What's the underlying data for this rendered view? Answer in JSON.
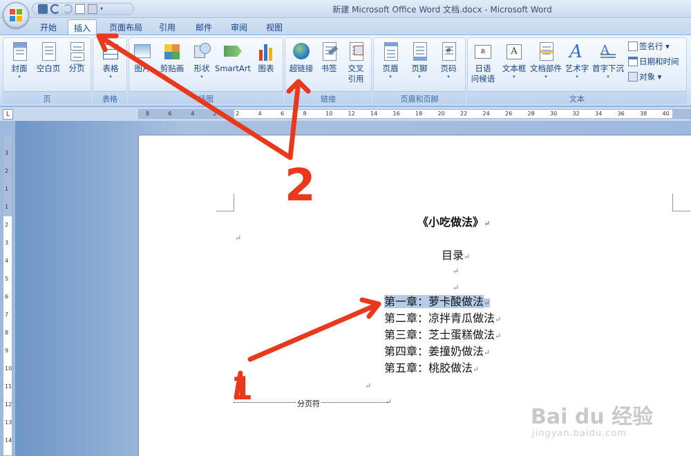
{
  "window": {
    "title": "新建 Microsoft Office Word 文档.docx - Microsoft Word"
  },
  "tabs": [
    "开始",
    "插入",
    "页面布局",
    "引用",
    "邮件",
    "审阅",
    "视图"
  ],
  "active_tab": "插入",
  "ribbon": {
    "groups": {
      "pages": {
        "label": "页",
        "cmds": [
          "封面",
          "空白页",
          "分页"
        ]
      },
      "tables": {
        "label": "表格",
        "cmds": [
          "表格"
        ]
      },
      "illustrations": {
        "label": "插图",
        "cmds": [
          "图片",
          "剪贴画",
          "形状",
          "SmartArt",
          "图表"
        ]
      },
      "links": {
        "label": "链接",
        "cmds": [
          "超链接",
          "书签",
          "交叉",
          "引用"
        ]
      },
      "header_footer": {
        "label": "页眉和页脚",
        "cmds": [
          "页眉",
          "页脚",
          "页码"
        ]
      },
      "text": {
        "label": "文本",
        "cmds": [
          "日语",
          "问候语",
          "文本框",
          "文档部件",
          "艺术字",
          "首字下沉"
        ],
        "small": [
          "签名行",
          "日期和时间",
          "对象"
        ]
      }
    }
  },
  "ruler": {
    "h_numbers": [
      "8",
      "6",
      "4",
      "2",
      "2",
      "4",
      "6",
      "8",
      "10",
      "12",
      "14",
      "16",
      "18",
      "20",
      "22",
      "24",
      "26",
      "28",
      "30",
      "32",
      "34",
      "36",
      "38",
      "40"
    ],
    "v_numbers": [
      "3",
      "2",
      "1",
      "1",
      "2",
      "3",
      "4",
      "5",
      "6",
      "7",
      "8",
      "9",
      "10",
      "11",
      "12",
      "13",
      "14"
    ]
  },
  "document": {
    "title": "《小吃做法》",
    "toc_heading": "目录",
    "toc": [
      "第一章：萝卡酸做法",
      "第二章：凉拌青瓜做法",
      "第三章：芝士蛋糕做法",
      "第四章：姜撞奶做法",
      "第五章：桃胶做法"
    ],
    "page_break_label": "分页符",
    "para_mark": "↵"
  },
  "annotations": {
    "label_1": "1",
    "label_2": "2"
  },
  "watermark": {
    "brand": "Bai du 经验",
    "url": "jingyan.baidu.com"
  },
  "colors": {
    "ribbon": "#dae7f6",
    "accent": "#15428b",
    "annotation": "#e8391c",
    "highlight": "#b6cbe8"
  }
}
